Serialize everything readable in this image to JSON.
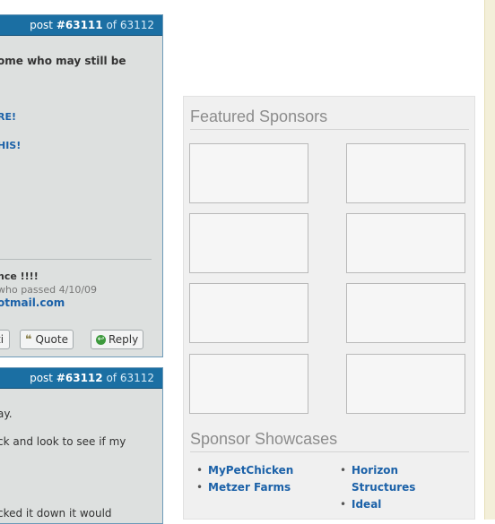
{
  "post1": {
    "header_label": "post ",
    "number": "#63111",
    "of_text": " of 63112",
    "line1": "ome who may still be",
    "link1": "RE!",
    "link2": "HIS!",
    "sig_line1": "nce !!!!",
    "sig_line2": " who passed 4/10/09",
    "sig_email": "otmail.com",
    "btn_partial": "ti",
    "btn_quote": "Quote",
    "btn_reply": "Reply"
  },
  "post2": {
    "header_label": "post ",
    "number": "#63112",
    "of_text": " of 63112",
    "line1": "ay.",
    "line2": "ck and look to see if my",
    "line3": "cked it down it would"
  },
  "sponsors": {
    "featured_heading": "Featured Sponsors",
    "showcases_heading": "Sponsor Showcases",
    "showcases_col1": [
      "MyPetChicken",
      "Metzer Farms"
    ],
    "showcases_col2": [
      "Horizon",
      "Structures",
      "Ideal"
    ]
  },
  "colors": {
    "header_blue": "#1b6fa3",
    "link_blue": "#1b61a8",
    "post_bg": "#dde0df"
  }
}
